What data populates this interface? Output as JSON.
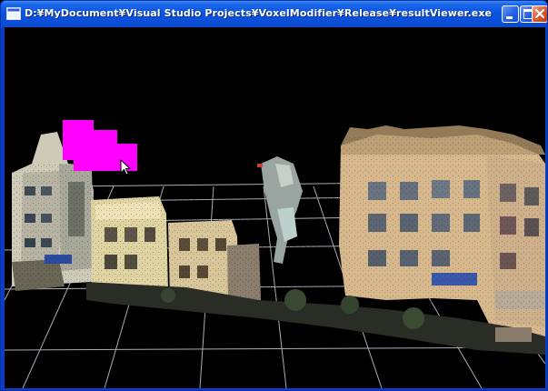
{
  "window": {
    "title": "D:¥MyDocument¥Visual Studio Projects¥VoxelModifier¥Release¥resultViewer.exe"
  },
  "colors": {
    "titlebar": "#0b54e0",
    "background": "#000000",
    "grid": "#cfd3e0",
    "selection": "#ff00ff"
  },
  "icons": {
    "app": "app-window-icon",
    "minimize": "minimize-icon",
    "maximize": "maximize-icon",
    "close": "close-icon",
    "cursor": "mouse-pointer-icon"
  }
}
